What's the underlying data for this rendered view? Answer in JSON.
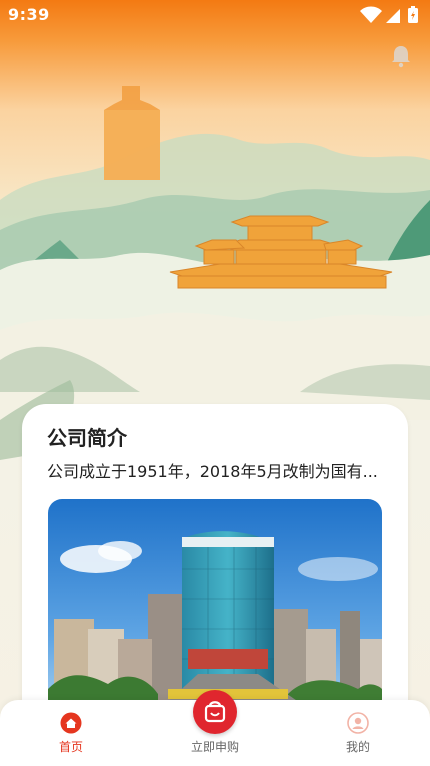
{
  "status_bar": {
    "time": "9:39"
  },
  "intro_card": {
    "title": "公司简介",
    "description": "公司成立于1951年，2018年5月改制为国有..."
  },
  "bottom_nav": {
    "items": [
      {
        "label": "首页",
        "icon": "home-icon",
        "active": true
      },
      {
        "label": "立即申购",
        "icon": "shopping-bag-icon",
        "active": false
      },
      {
        "label": "我的",
        "icon": "user-icon",
        "active": false
      }
    ]
  },
  "colors": {
    "accent": "#e5361f",
    "header_orange": "#f47a12",
    "apply_red": "#e0262e"
  }
}
